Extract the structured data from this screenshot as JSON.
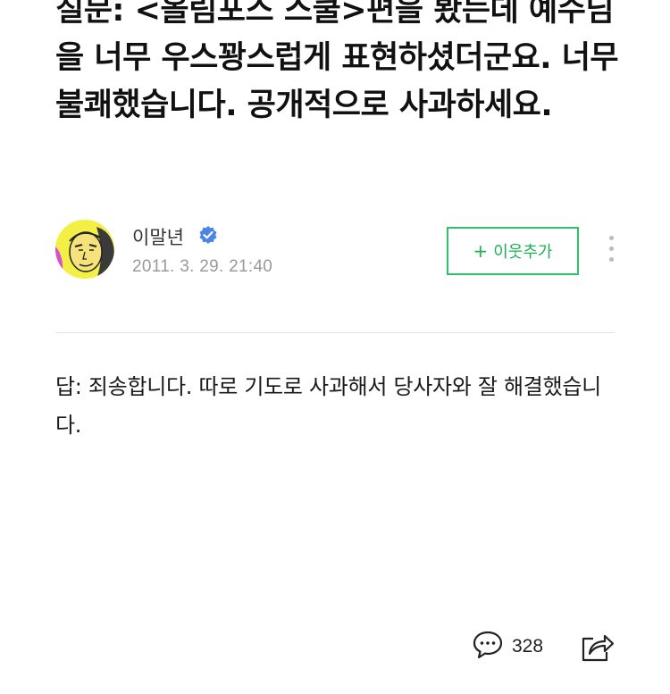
{
  "post": {
    "title": "질문: <올림포스 스쿨>편을 봤는데 예수님을 너무 우스꽝스럽게 표현하셨더군요. 너무 불쾌했습니다. 공개적으로 사과하세요.",
    "author": {
      "name": "이말년",
      "date": "2011. 3. 29. 21:40",
      "verified_icon": "verified-check-icon",
      "avatar_icon": "caricature-avatar"
    },
    "follow_button": {
      "plus": "+",
      "label": "이웃추가"
    },
    "more_icon": "vertical-ellipsis-icon",
    "answer": "답: 죄송합니다. 따로 기도로 사과해서 당사자와 잘 해결했습니다."
  },
  "footer": {
    "comment_icon": "speech-bubble-icon",
    "comment_count": "328",
    "share_icon": "share-arrow-icon"
  },
  "colors": {
    "accent_green": "#2ec26b",
    "verified_blue": "#4a86e8",
    "text_muted": "#999999"
  }
}
